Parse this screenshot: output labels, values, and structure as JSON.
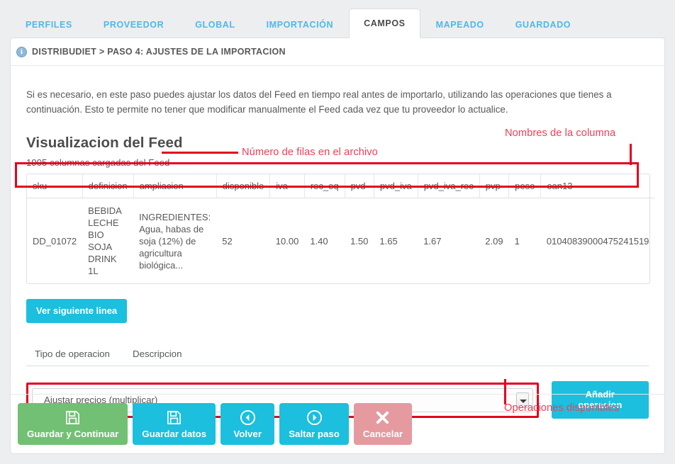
{
  "tabs": [
    {
      "label": "PERFILES",
      "active": false
    },
    {
      "label": "PROVEEDOR",
      "active": false
    },
    {
      "label": "GLOBAL",
      "active": false
    },
    {
      "label": "IMPORTACIÓN",
      "active": false
    },
    {
      "label": "CAMPOS",
      "active": true
    },
    {
      "label": "MAPEADO",
      "active": false
    },
    {
      "label": "GUARDADO",
      "active": false
    }
  ],
  "breadcrumb": {
    "icon": "info-circle-icon",
    "text": "DISTRIBUDIET > PASO 4: AJUSTES DE LA IMPORTACION"
  },
  "intro": "Si es necesario, en este paso puedes ajustar los datos del Feed en tiempo real antes de importarlo, utilizando las operaciones que tienes a continuación. Esto te permite no tener que modificar manualmente el Feed cada vez que tu proveedor lo actualice.",
  "feed": {
    "title": "Visualizacion del Feed",
    "row_count_text": "1905 columnas cargadas del Feed",
    "columns": [
      "sku",
      "definicion",
      "ampliacion",
      "disponible",
      "iva",
      "rec_eq",
      "pvd",
      "pvd_iva",
      "pvd_iva_rec",
      "pvp",
      "peso",
      "ean13"
    ],
    "rows": [
      {
        "sku": "DD_01072",
        "definicion": "BEBIDA LECHE BIO SOJA DRINK 1L",
        "ampliacion": "INGREDIENTES: Agua, habas de soja (12%) de agricultura biológica...",
        "disponible": "52",
        "iva": "10.00",
        "rec_eq": "1.40",
        "pvd": "1.50",
        "pvd_iva": "1.65",
        "pvd_iva_rec": "1.67",
        "pvp": "2.09",
        "peso": "1",
        "ean13": "01040839000475241519"
      }
    ],
    "next_line_button": "Ver siguiente linea"
  },
  "operations": {
    "col_type": "Tipo de operacion",
    "col_description": "Descripcion",
    "selected": "Ajustar precios (multiplicar)",
    "options": [
      "Ajustar precios (multiplicar)"
    ],
    "add_button": "Añadir operacion"
  },
  "footer": {
    "save_continue": "Guardar y Continuar",
    "save_data": "Guardar datos",
    "back": "Volver",
    "skip": "Saltar paso",
    "cancel": "Cancelar",
    "icons": [
      "floppy-disk-icon",
      "floppy-disk-icon",
      "arrow-left-circle-icon",
      "arrow-right-circle-icon",
      "cross-x-icon"
    ]
  },
  "annotations": {
    "row_number": "Número de filas en el archivo",
    "column_names": "Nombres de la columna",
    "available_operations": "Operaciones disponibles"
  },
  "colors": {
    "accent_cyan": "#1cbfdd",
    "tab_link": "#4fb8e8",
    "annotation_red": "#ef3e56",
    "outline_red": "#e3001f",
    "green": "#71c073",
    "danger": "#e59a9f",
    "page_bg": "#eceef0"
  }
}
